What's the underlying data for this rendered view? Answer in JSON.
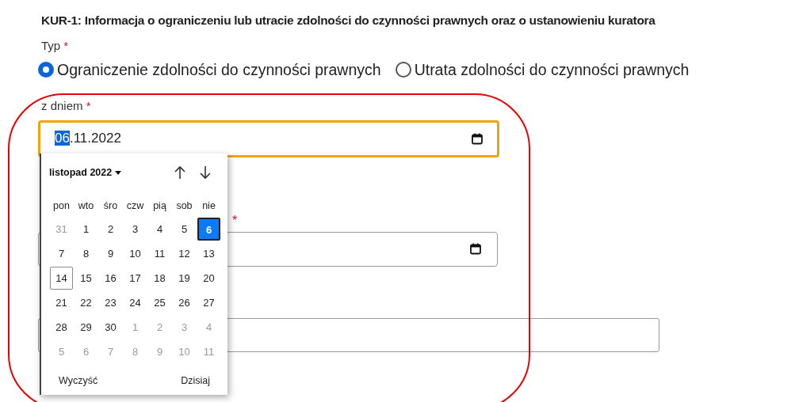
{
  "title": "KUR-1: Informacja o ograniczeniu lub utracie zdolności do czynności prawnych oraz o ustanowieniu kuratora",
  "type_field": {
    "label": "Typ",
    "required_mark": "*",
    "options": [
      {
        "label": "Ograniczenie zdolności do czynności prawnych",
        "selected": true
      },
      {
        "label": "Utrata zdolności do czynności prawnych",
        "selected": false
      }
    ]
  },
  "date_field": {
    "label": "z dniem",
    "required_mark": "*",
    "value_day": "06",
    "value_rest": ".11.2022",
    "focused": true
  },
  "second_date_field": {
    "required_mark": "*"
  },
  "datepicker": {
    "month": "listopad 2022",
    "weekdays": [
      "pon",
      "wto",
      "śro",
      "czw",
      "pią",
      "sob",
      "nie"
    ],
    "days": [
      {
        "label": "31",
        "muted": true,
        "selected": false,
        "today": false
      },
      {
        "label": "1",
        "muted": false,
        "selected": false,
        "today": false
      },
      {
        "label": "2",
        "muted": false,
        "selected": false,
        "today": false
      },
      {
        "label": "3",
        "muted": false,
        "selected": false,
        "today": false
      },
      {
        "label": "4",
        "muted": false,
        "selected": false,
        "today": false
      },
      {
        "label": "5",
        "muted": false,
        "selected": false,
        "today": false
      },
      {
        "label": "6",
        "muted": false,
        "selected": true,
        "today": false
      },
      {
        "label": "7",
        "muted": false,
        "selected": false,
        "today": false
      },
      {
        "label": "8",
        "muted": false,
        "selected": false,
        "today": false
      },
      {
        "label": "9",
        "muted": false,
        "selected": false,
        "today": false
      },
      {
        "label": "10",
        "muted": false,
        "selected": false,
        "today": false
      },
      {
        "label": "11",
        "muted": false,
        "selected": false,
        "today": false
      },
      {
        "label": "12",
        "muted": false,
        "selected": false,
        "today": false
      },
      {
        "label": "13",
        "muted": false,
        "selected": false,
        "today": false
      },
      {
        "label": "14",
        "muted": false,
        "selected": false,
        "today": true
      },
      {
        "label": "15",
        "muted": false,
        "selected": false,
        "today": false
      },
      {
        "label": "16",
        "muted": false,
        "selected": false,
        "today": false
      },
      {
        "label": "17",
        "muted": false,
        "selected": false,
        "today": false
      },
      {
        "label": "18",
        "muted": false,
        "selected": false,
        "today": false
      },
      {
        "label": "19",
        "muted": false,
        "selected": false,
        "today": false
      },
      {
        "label": "20",
        "muted": false,
        "selected": false,
        "today": false
      },
      {
        "label": "21",
        "muted": false,
        "selected": false,
        "today": false
      },
      {
        "label": "22",
        "muted": false,
        "selected": false,
        "today": false
      },
      {
        "label": "23",
        "muted": false,
        "selected": false,
        "today": false
      },
      {
        "label": "24",
        "muted": false,
        "selected": false,
        "today": false
      },
      {
        "label": "25",
        "muted": false,
        "selected": false,
        "today": false
      },
      {
        "label": "26",
        "muted": false,
        "selected": false,
        "today": false
      },
      {
        "label": "27",
        "muted": false,
        "selected": false,
        "today": false
      },
      {
        "label": "28",
        "muted": false,
        "selected": false,
        "today": false
      },
      {
        "label": "29",
        "muted": false,
        "selected": false,
        "today": false
      },
      {
        "label": "30",
        "muted": false,
        "selected": false,
        "today": false
      },
      {
        "label": "1",
        "muted": true,
        "selected": false,
        "today": false
      },
      {
        "label": "2",
        "muted": true,
        "selected": false,
        "today": false
      },
      {
        "label": "3",
        "muted": true,
        "selected": false,
        "today": false
      },
      {
        "label": "4",
        "muted": true,
        "selected": false,
        "today": false
      },
      {
        "label": "5",
        "muted": true,
        "selected": false,
        "today": false
      },
      {
        "label": "6",
        "muted": true,
        "selected": false,
        "today": false
      },
      {
        "label": "7",
        "muted": true,
        "selected": false,
        "today": false
      },
      {
        "label": "8",
        "muted": true,
        "selected": false,
        "today": false
      },
      {
        "label": "9",
        "muted": true,
        "selected": false,
        "today": false
      },
      {
        "label": "10",
        "muted": true,
        "selected": false,
        "today": false
      },
      {
        "label": "11",
        "muted": true,
        "selected": false,
        "today": false
      }
    ],
    "clear": "Wyczyść",
    "today": "Dzisiaj"
  }
}
